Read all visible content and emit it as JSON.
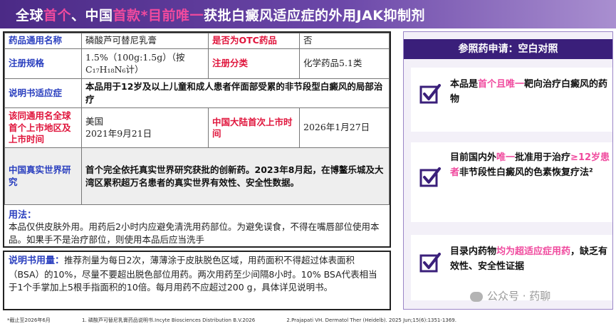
{
  "title": {
    "part1": "全球",
    "part2": "首个",
    "part3": "、中国",
    "part4": "首款",
    "part5": "*目前唯一",
    "part6": "获批白癜风适应症的外用JAK抑制剂"
  },
  "table": {
    "generic_name_label": "药品通用名称",
    "generic_name_value": "磷酸芦可替尼乳膏",
    "otc_label": "是否为OTC药品",
    "otc_value": "否",
    "spec_label": "注册规格",
    "spec_value": "1.5%（100g:1.5g）（按C₁₇H₁₈N₆计）",
    "category_label": "注册分类",
    "category_value": "化学药品5.1类",
    "indication_label": "说明书适应症",
    "indication_value": "本品用于12岁及以上儿童和成人患者伴面部受累的非节段型白癜风的局部治疗",
    "first_launch_label": "该同通用名全球首个上市地区及上市时间",
    "first_launch_value_line1": "美国",
    "first_launch_value_line2": "2021年9月21日",
    "china_launch_label": "中国大陆首次上市时间",
    "china_launch_value": "2026年1月27日",
    "rwe_label": "中国真实世界研究",
    "rwe_value": "首个完全依托真实世界研究获批的创新药。2023年8月起，在博鳌乐城及大湾区累积超万名患者的真实世界有效性、安全性数据。"
  },
  "usage": {
    "heading": "用法：",
    "text": "本品仅供皮肤外用。用药后2小时内应避免清洗用药部位。为避免误食，不得在嘴唇部位使用本品。如果手不是治疗部位，则使用本品后应当洗手"
  },
  "dosage": {
    "heading": "说明书用量：",
    "text": "推荐剂量为每日2次，薄薄涂于皮肤脱色区域，用药面积不得超过体表面积（BSA）的10%，尽量不要超出脱色部位用药。两次用药至少间隔8小时。10% BSA代表相当于1个手掌加上5根手指面积的10倍。每月用药不应超过200 g，具体详见说明书。"
  },
  "right": {
    "header": "参照药申请：空白对照",
    "f1_a": "本品是",
    "f1_b": "首个且唯一",
    "f1_c": "靶向治疗白癜风的药物",
    "f2_a": "目前国内外",
    "f2_b": "唯一",
    "f2_c": "批准用于治疗",
    "f2_d": "≥12岁患者",
    "f2_e": "非节段性白癜风的色素恢复疗法²",
    "f3_a": "目录内药物",
    "f3_b": "均为超适应症用药",
    "f3_c": "，缺乏有效性、安全性证据",
    "check_icon": "checkbox-check-icon",
    "accent": "#3a1f7a",
    "highlight": "#f04a9e"
  },
  "watermark": "公众号 · 药聊",
  "footer": {
    "note1": "*截止至2026年6月",
    "note2": "1. 磷酸芦可替尼乳膏药品说明书.Incyte Biosciences Distribution B.V.2026",
    "note3": "2.Prajapati VH. Dermatol Ther (Heidelb). 2025 Jun;15(6):1351-1369."
  }
}
